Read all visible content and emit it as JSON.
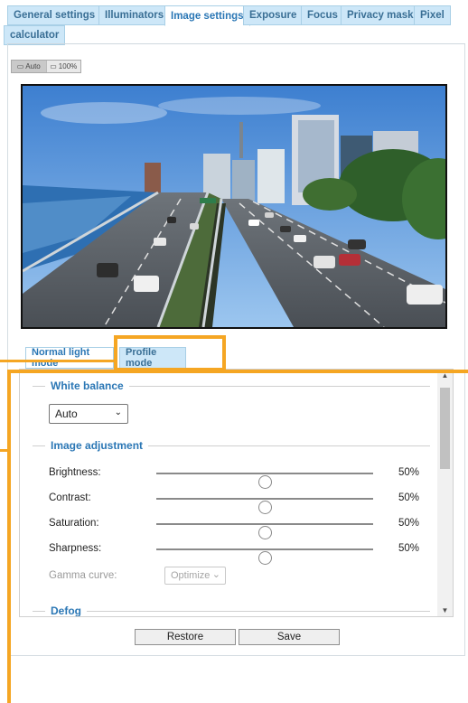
{
  "tabs": [
    {
      "label": "General settings",
      "active": false
    },
    {
      "label": "Illuminators",
      "active": false
    },
    {
      "label": "Image settings",
      "active": true
    },
    {
      "label": "Exposure",
      "active": false
    },
    {
      "label": "Focus",
      "active": false
    },
    {
      "label": "Privacy mask",
      "active": false
    },
    {
      "label": "Pixel",
      "active": false
    },
    {
      "label": "calculator",
      "active": false
    }
  ],
  "view_buttons": [
    {
      "label": "Auto",
      "icon": "fit-window-icon",
      "selected": true
    },
    {
      "label": "100%",
      "icon": "actual-size-icon",
      "selected": false
    }
  ],
  "mode_tabs": [
    {
      "label": "Normal light mode",
      "selected": false
    },
    {
      "label": "Profile mode",
      "selected": true
    }
  ],
  "white_balance": {
    "heading": "White balance",
    "value": "Auto"
  },
  "image_adjustment": {
    "heading": "Image adjustment",
    "sliders": [
      {
        "label": "Brightness:",
        "value": "50%",
        "level": 0.5
      },
      {
        "label": "Contrast:",
        "value": "50%",
        "level": 0.5
      },
      {
        "label": "Saturation:",
        "value": "50%",
        "level": 0.5
      },
      {
        "label": "Sharpness:",
        "value": "50%",
        "level": 0.5
      }
    ],
    "gamma_label": "Gamma curve:",
    "gamma_value": "Optimize"
  },
  "defog_heading": "Defog",
  "buttons": {
    "restore": "Restore",
    "save": "Save"
  },
  "colors": {
    "accent": "#2b77b5",
    "tab_bg": "#cde7f8",
    "callout": "#f5a623"
  }
}
